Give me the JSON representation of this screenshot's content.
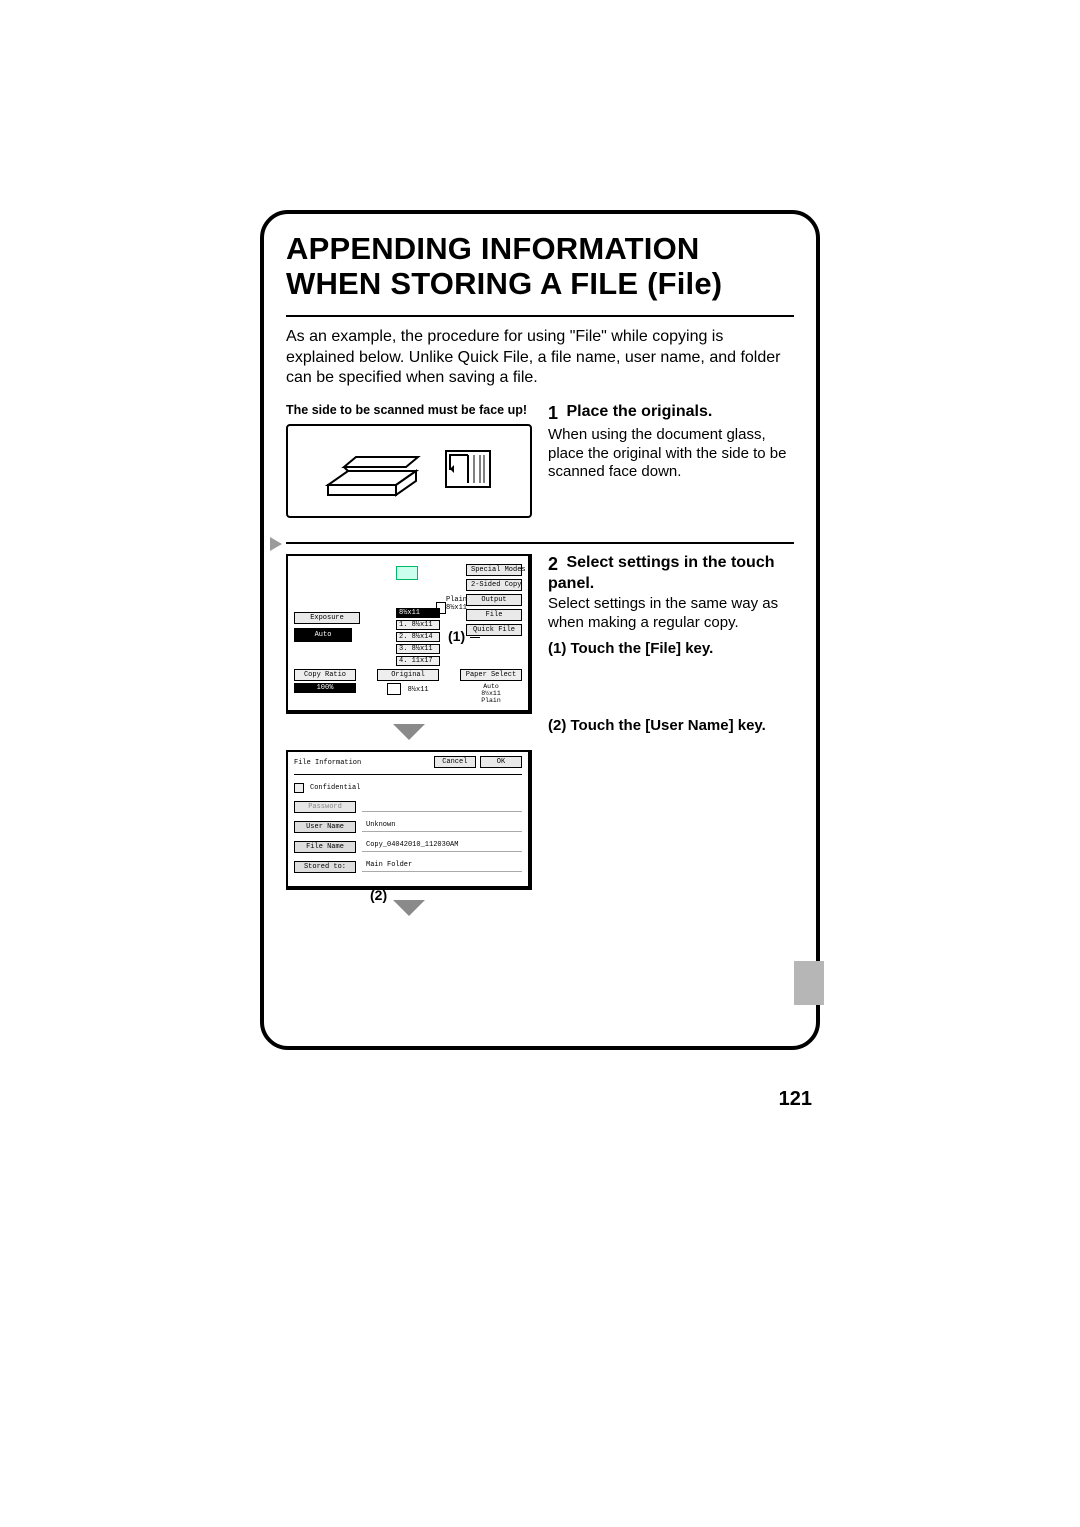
{
  "title": "APPENDING INFORMATION WHEN STORING A FILE (File)",
  "intro": "As an example, the procedure for using \"File\" while copying is explained below. Unlike Quick File, a file name, user name, and folder can be specified when saving a file.",
  "page_number": "121",
  "step1": {
    "caption": "The side to be scanned must be face up!",
    "head": "Place the originals.",
    "body": "When using the document glass, place the original with the side to be scanned face down."
  },
  "step2": {
    "head": "Select settings in the touch panel.",
    "body": "Select settings in the same way as when making a regular copy.",
    "sub1": "(1) Touch the [File] key.",
    "sub2": "(2) Touch the [User Name] key."
  },
  "panel": {
    "special_modes": "Special Modes",
    "two_sided": "2-Sided Copy",
    "output": "Output",
    "file": "File",
    "quick_file": "Quick File",
    "plain": "Plain",
    "size": "8½x11",
    "exposure_label": "Exposure",
    "auto": "Auto",
    "copy_ratio": "Copy Ratio",
    "copy_ratio_val": "100%",
    "original": "Original",
    "original_val": "8½x11",
    "paper_select": "Paper Select",
    "paper_1": "Auto",
    "paper_2": "8½x11",
    "paper_3": "Plain",
    "c1": "(1)",
    "tray_head": "8½x11",
    "tray_1": "1. 8½x11",
    "tray_1_icon": "▢",
    "tray_2": "2. 8½x14",
    "tray_2_icon": "☰",
    "tray_3": "3. 8½x11",
    "tray_3_icon": "☰",
    "tray_4": "4. 11x17",
    "tray_4_icon": "☰"
  },
  "panel2": {
    "title": "File Information",
    "cancel": "Cancel",
    "ok": "OK",
    "confidential": "Confidential",
    "password": "Password",
    "user_name": "User Name",
    "user_name_val": "Unknown",
    "file_name": "File Name",
    "file_name_val": "Copy_04042010_112030AM",
    "stored_to": "Stored to:",
    "stored_to_val": "Main Folder",
    "c2": "(2)"
  }
}
